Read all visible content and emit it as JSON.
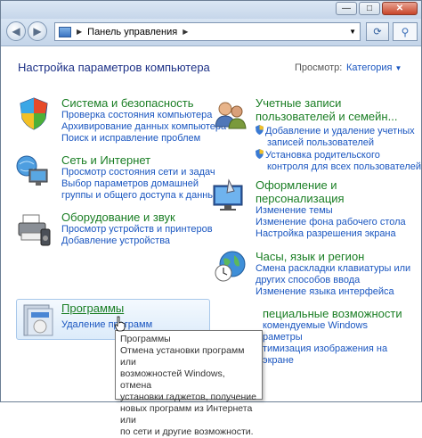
{
  "breadcrumb": {
    "root": "Панель управления"
  },
  "header": {
    "title": "Настройка параметров компьютера",
    "view_by_label": "Просмотр:",
    "view_by_value": "Категория"
  },
  "categories": [
    {
      "title": "Система и безопасность",
      "links": [
        "Проверка состояния компьютера",
        "Архивирование данных компьютера",
        "Поиск и исправление проблем"
      ],
      "icon": "shield-icon"
    },
    {
      "title": "Сеть и Интернет",
      "links": [
        "Просмотр состояния сети и задач",
        "Выбор параметров домашней",
        "группы и общего доступа к данным"
      ],
      "icon": "network-icon"
    },
    {
      "title": "Оборудование и звук",
      "links": [
        "Просмотр устройств и принтеров",
        "Добавление устройства"
      ],
      "icon": "printer-icon"
    },
    {
      "title": "Программы",
      "links": [
        "Удаление программ"
      ],
      "icon": "programs-icon"
    }
  ],
  "right_categories": [
    {
      "title_line1": "Учетные записи",
      "title_line2": "пользователей и семейн...",
      "links": [
        "Добавление и удаление учетных",
        "записей пользователей",
        "Установка родительского",
        "контроля для всех пользователей"
      ],
      "icon": "users-icon"
    },
    {
      "title_line1": "Оформление и",
      "title_line2": "персонализация",
      "links": [
        "Изменение темы",
        "Изменение фона рабочего стола",
        "Настройка разрешения экрана"
      ],
      "icon": "appearance-icon"
    },
    {
      "title_line1": "Часы, язык и регион",
      "links": [
        "Смена раскладки клавиатуры или",
        "других способов ввода",
        "Изменение языка интерфейса"
      ],
      "icon": "globe-clock-icon"
    },
    {
      "title_line1": "пециальные возможности",
      "links": [
        "комендуемые Windows",
        "раметры",
        "тимизация изображения на",
        "экране"
      ],
      "icon": "accessibility-icon"
    }
  ],
  "tooltip": {
    "title": "Программы",
    "lines": [
      "Отмена установки программ или",
      "возможностей Windows, отмена",
      "установки гаджетов, получение",
      "новых программ из Интернета или",
      "по сети и другие возможности."
    ]
  }
}
